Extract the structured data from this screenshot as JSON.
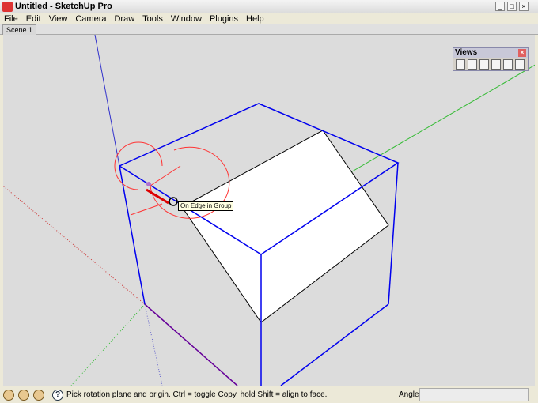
{
  "window": {
    "title": "Untitled - SketchUp Pro"
  },
  "menu": [
    "File",
    "Edit",
    "View",
    "Camera",
    "Draw",
    "Tools",
    "Window",
    "Plugins",
    "Help"
  ],
  "scenes": [
    "Scene 1"
  ],
  "views_toolbar": {
    "title": "Views",
    "icons": [
      "iso-icon",
      "front-icon",
      "top-icon",
      "right-icon",
      "back-icon",
      "left-icon"
    ]
  },
  "tooltip": "On Edge in Group",
  "status": {
    "hint": "Pick rotation plane and origin.  Ctrl = toggle Copy, hold Shift = align to face.",
    "measure_label": "Angle",
    "measure_value": ""
  },
  "colors": {
    "edge_selected": "#0000ee",
    "protractor": "#ff3333",
    "axis_green": "#33bb33",
    "axis_red": "#cc3333"
  }
}
